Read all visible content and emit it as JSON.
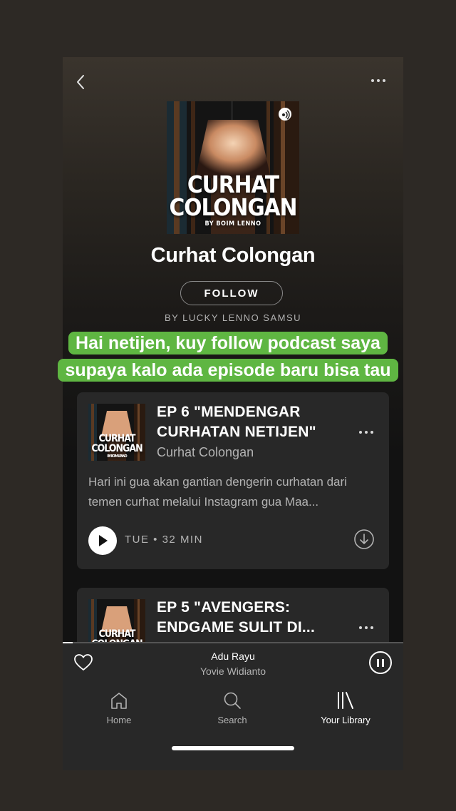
{
  "header": {
    "back_icon": "chevron-left-icon",
    "more_icon": "more-horizontal-icon"
  },
  "podcast": {
    "cover_line1": "CURHAT",
    "cover_line2": "COLONGAN",
    "cover_byline": "BY BOIM LENNO",
    "title": "Curhat Colongan",
    "follow_label": "FOLLOW",
    "author": "BY LUCKY LENNO SAMSU"
  },
  "overlay": {
    "line1": "Hai netijen, kuy follow podcast saya",
    "line2": "supaya kalo ada episode baru bisa tau",
    "background_color": "#5fb642"
  },
  "episodes": [
    {
      "thumb_line1": "CURHAT",
      "thumb_line2": "COLONGAN",
      "thumb_byline": "BY BOIM LENNO",
      "title": "EP 6 \"MENDENGAR CURHATAN NETIJEN\"",
      "show": "Curhat Colongan",
      "description": "Hari ini gua akan gantian dengerin curhatan dari temen curhat melalui Instagram gua Maa...",
      "meta": "TUE • 32 MIN"
    },
    {
      "thumb_line1": "CURHAT",
      "thumb_line2": "COLONGAN",
      "title": "EP 5 \"AVENGERS: ENDGAME SULIT DI..."
    }
  ],
  "now_playing": {
    "title": "Adu Rayu",
    "artist": "Yovie Widianto",
    "progress": 0.03
  },
  "tabs": [
    {
      "label": "Home",
      "icon": "home-icon",
      "active": false
    },
    {
      "label": "Search",
      "icon": "search-icon",
      "active": false
    },
    {
      "label": "Your Library",
      "icon": "library-icon",
      "active": true
    }
  ],
  "colors": {
    "background": "#121212",
    "card": "#282828",
    "secondary_text": "#b3b3b3",
    "accent_green": "#5fb642"
  }
}
